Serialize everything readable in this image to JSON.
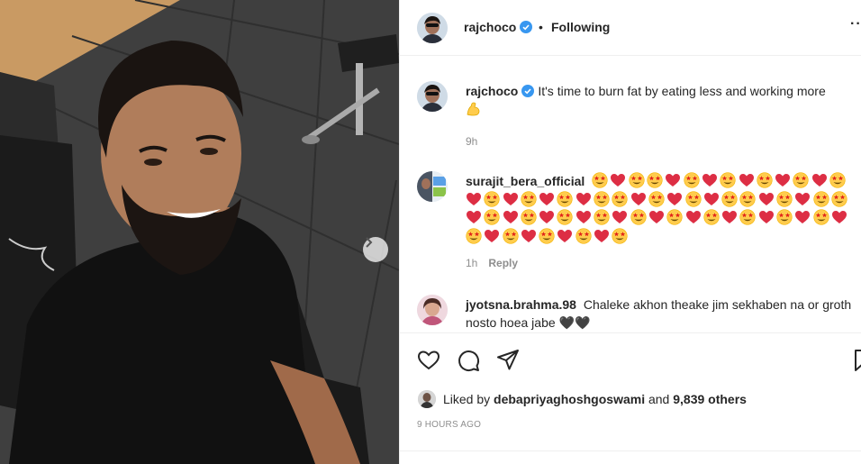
{
  "post_author": {
    "username": "rajchoco",
    "verified": true,
    "follow_status": "Following",
    "separator": "•"
  },
  "caption": {
    "username": "rajchoco",
    "text": "It's time to burn fat by eating less and working more",
    "emoji_icon": "flexed-biceps-emoji",
    "time": "9h"
  },
  "comments": [
    {
      "username": "surajit_bera_official",
      "emoji_pattern": [
        "star-eyes",
        "heart",
        "star-eyes",
        "star-eyes",
        "heart",
        "star-eyes",
        "heart",
        "star-eyes",
        "heart",
        "star-eyes",
        "heart",
        "star-eyes",
        "heart",
        "star-eyes",
        "heart",
        "star-eyes",
        "heart",
        "star-eyes",
        "heart",
        "star-eyes",
        "heart",
        "star-eyes",
        "star-eyes",
        "heart",
        "star-eyes",
        "heart",
        "star-eyes",
        "heart",
        "star-eyes",
        "star-eyes",
        "heart",
        "star-eyes",
        "heart",
        "star-eyes",
        "star-eyes",
        "heart",
        "star-eyes",
        "heart",
        "star-eyes",
        "heart",
        "star-eyes",
        "heart",
        "star-eyes",
        "heart",
        "star-eyes",
        "heart",
        "star-eyes",
        "heart",
        "star-eyes",
        "heart",
        "star-eyes",
        "heart",
        "star-eyes",
        "heart",
        "star-eyes",
        "heart",
        "star-eyes",
        "heart",
        "star-eyes",
        "heart",
        "star-eyes",
        "heart",
        "star-eyes",
        "heart",
        "star-eyes"
      ],
      "time": "1h",
      "reply_label": "Reply"
    },
    {
      "username": "jyotsna.brahma.98",
      "text": "Chaleke akhon theake jim sekhaben na or groth nosto hoea jabe",
      "trailing_emoji": "🖤🖤"
    }
  ],
  "likes": {
    "prefix": "Liked by",
    "user": "debapriyaghoshgoswami",
    "conj": "and",
    "others": "9,839 others"
  },
  "timestamp": "9 HOURS AGO",
  "colors": {
    "verified_blue": "#3897f0",
    "muted": "#8e8e8e",
    "text": "#262626",
    "heart_red": "#dd2e44",
    "emoji_yellow": "#ffcc4d"
  },
  "icons": [
    "like-heart-icon",
    "comment-icon",
    "share-icon",
    "bookmark-icon",
    "next-arrow-icon",
    "more-options-icon",
    "verified-badge-icon"
  ]
}
